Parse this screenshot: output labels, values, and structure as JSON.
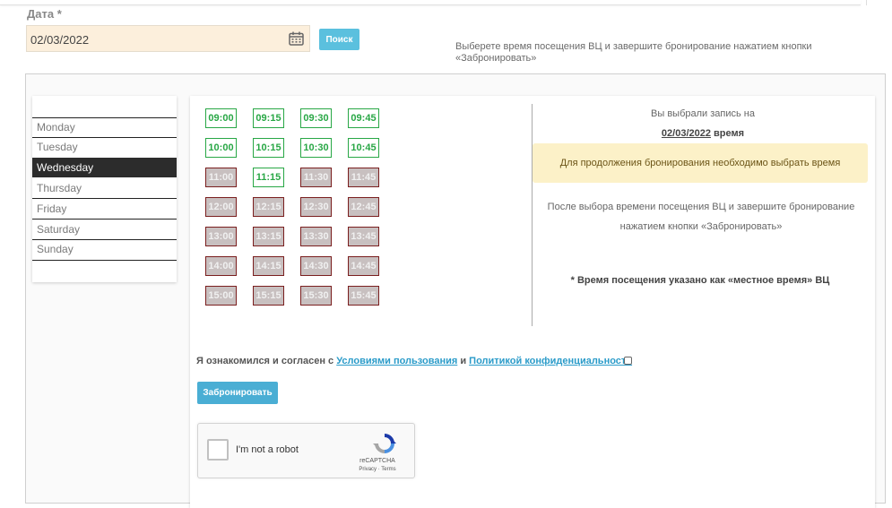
{
  "date_section": {
    "label": "Дата *",
    "value": "02/03/2022",
    "search_label": "Поиск",
    "hint": "Выберете время посещения ВЦ и завершите бронирование нажатием кнопки «Забронировать»"
  },
  "days": [
    {
      "label": "Monday",
      "active": false
    },
    {
      "label": "Tuesday",
      "active": false
    },
    {
      "label": "Wednesday",
      "active": true
    },
    {
      "label": "Thursday",
      "active": false
    },
    {
      "label": "Friday",
      "active": false
    },
    {
      "label": "Saturday",
      "active": false
    },
    {
      "label": "Sunday",
      "active": false
    }
  ],
  "slots": [
    {
      "time": "09:00",
      "available": true
    },
    {
      "time": "09:15",
      "available": true
    },
    {
      "time": "09:30",
      "available": true
    },
    {
      "time": "09:45",
      "available": true
    },
    {
      "time": "10:00",
      "available": true
    },
    {
      "time": "10:15",
      "available": true
    },
    {
      "time": "10:30",
      "available": true
    },
    {
      "time": "10:45",
      "available": true
    },
    {
      "time": "11:00",
      "available": false
    },
    {
      "time": "11:15",
      "available": true
    },
    {
      "time": "11:30",
      "available": false
    },
    {
      "time": "11:45",
      "available": false
    },
    {
      "time": "12:00",
      "available": false
    },
    {
      "time": "12:15",
      "available": false
    },
    {
      "time": "12:30",
      "available": false
    },
    {
      "time": "12:45",
      "available": false
    },
    {
      "time": "13:00",
      "available": false
    },
    {
      "time": "13:15",
      "available": false
    },
    {
      "time": "13:30",
      "available": false
    },
    {
      "time": "13:45",
      "available": false
    },
    {
      "time": "14:00",
      "available": false
    },
    {
      "time": "14:15",
      "available": false
    },
    {
      "time": "14:30",
      "available": false
    },
    {
      "time": "14:45",
      "available": false
    },
    {
      "time": "15:00",
      "available": false
    },
    {
      "time": "15:15",
      "available": false
    },
    {
      "time": "15:30",
      "available": false
    },
    {
      "time": "15:45",
      "available": false
    }
  ],
  "selection": {
    "title": "Вы выбрали запись на",
    "date": "02/03/2022",
    "time_word": "время",
    "alert": "Для продолжения бронирования необходимо выбрать время",
    "after_text": "После выбора времени посещения ВЦ и завершите бронирование нажатием кнопки «Забронировать»",
    "note": "* Время посещения указано как «местное время» ВЦ"
  },
  "agreement": {
    "prefix": "Я ознакомился и согласен с",
    "terms_link": "Условиями пользования",
    "and": "и",
    "privacy_link": "Политикой конфиденциальности"
  },
  "book_button": "Забронировать",
  "captcha": {
    "label": "I'm not a robot",
    "brand": "reCAPTCHA",
    "privacy": "Privacy",
    "terms": "Terms"
  },
  "colors": {
    "free_slot": "#28a745",
    "busy_slot_bg": "#c8c0c0",
    "busy_slot_border": "#7a1e1e",
    "button": "#5bc0de",
    "link": "#2a9bc9",
    "alert_bg": "#fcf1c8",
    "date_field_bg": "#fcefdc"
  }
}
